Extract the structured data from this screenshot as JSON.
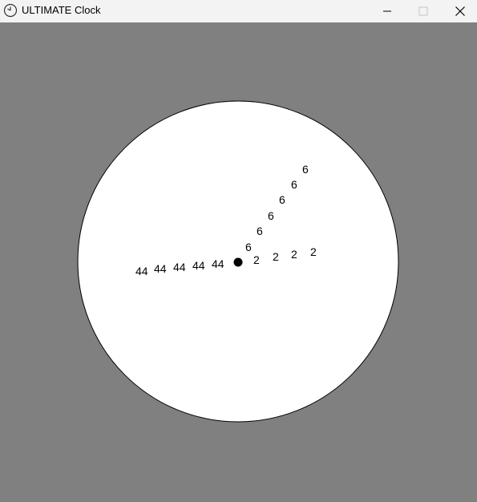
{
  "window": {
    "title": "ULTIMATE Clock",
    "icon": "clock-icon",
    "controls": {
      "minimize": "minimize-icon",
      "maximize": "maximize-icon",
      "close": "close-icon"
    }
  },
  "clock": {
    "hour_hand_label": "2",
    "minute_hand_label": "44",
    "second_hand_label": "6",
    "colors": {
      "background": "#808080",
      "face": "#ffffff",
      "outline": "#000000",
      "text": "#000000"
    }
  }
}
